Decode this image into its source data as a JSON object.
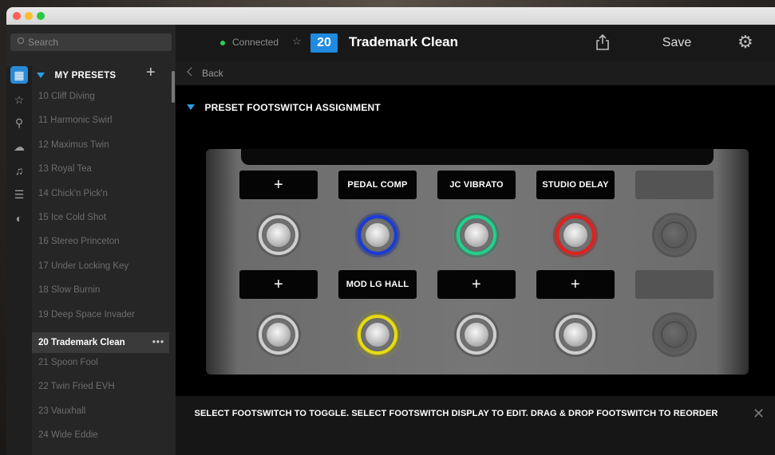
{
  "sidebar": {
    "search_placeholder": "Search",
    "section_title": "MY PRESETS",
    "add_label": "+",
    "icons": [
      "presets-icon",
      "favorites-icon",
      "setlist-icon",
      "cloud-icon",
      "music-icon",
      "list-icon",
      "tone-icon"
    ],
    "presets": [
      {
        "label": "10 Cliff Diving"
      },
      {
        "label": "11 Harmonic Swirl"
      },
      {
        "label": "12 Maximus Twin"
      },
      {
        "label": "13 Royal Tea"
      },
      {
        "label": "14 Chick'n Pick'n"
      },
      {
        "label": "15 Ice Cold Shot"
      },
      {
        "label": "16 Stereo Princeton"
      },
      {
        "label": "17 Under Locking Key"
      },
      {
        "label": "18 Slow Burnin"
      },
      {
        "label": "19 Deep Space Invader"
      },
      {
        "label": "20 Trademark Clean",
        "selected": true,
        "more": "•••"
      },
      {
        "label": "21 Spoon Fool"
      },
      {
        "label": "22 Twin Fried EVH"
      },
      {
        "label": "23 Vauxhall"
      },
      {
        "label": "24 Wide Eddie"
      }
    ]
  },
  "header": {
    "status": "Connected",
    "preset_number": "20",
    "preset_name": "Trademark Clean",
    "save_label": "Save"
  },
  "content": {
    "back_label": "Back",
    "section_title": "PRESET FOOTSWITCH ASSIGNMENT",
    "footswitch_rows": [
      [
        {
          "label": "+",
          "plus": true,
          "color": "#cfcfcf"
        },
        {
          "label": "PEDAL COMP",
          "color": "#1a3bd6"
        },
        {
          "label": "JC VIBRATO",
          "color": "#22d08c"
        },
        {
          "label": "STUDIO DELAY",
          "color": "#e0211e"
        },
        {
          "label": "",
          "disabled": true,
          "color": "#5e5e5e"
        }
      ],
      [
        {
          "label": "+",
          "plus": true,
          "color": "#cfcfcf"
        },
        {
          "label": "MOD LG HALL",
          "color": "#e6dc12"
        },
        {
          "label": "+",
          "plus": true,
          "color": "#cfcfcf"
        },
        {
          "label": "+",
          "plus": true,
          "color": "#cfcfcf"
        },
        {
          "label": "",
          "disabled": true,
          "color": "#5e5e5e"
        }
      ]
    ],
    "instruction": "SELECT FOOTSWITCH TO TOGGLE. SELECT FOOTSWITCH DISPLAY TO EDIT. DRAG & DROP FOOTSWITCH TO REORDER"
  }
}
